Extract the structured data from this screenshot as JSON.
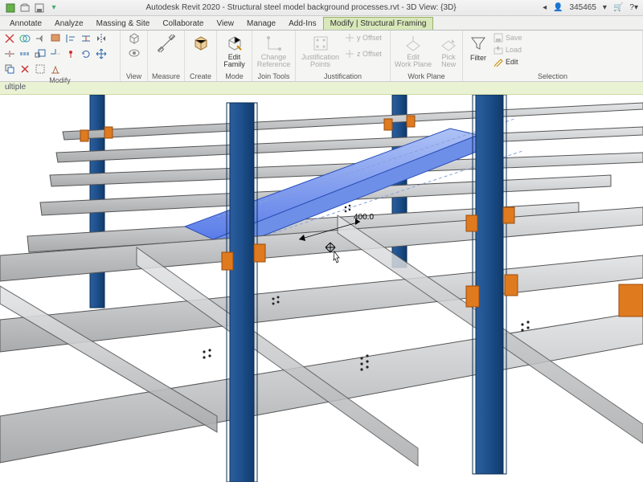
{
  "title": "Autodesk Revit 2020 - Structural steel model background processes.rvt - 3D View: {3D}",
  "user_count": "345465",
  "tabs": {
    "items": [
      "Annotate",
      "Analyze",
      "Massing & Site",
      "Collaborate",
      "View",
      "Manage",
      "Add-Ins"
    ],
    "active": "Modify | Structural Framing"
  },
  "ribbon": {
    "modify": {
      "label": "Modify"
    },
    "view": {
      "label": "View"
    },
    "measure": {
      "label": "Measure"
    },
    "create": {
      "label": "Create"
    },
    "mode": {
      "label": "Mode",
      "edit_family": "Edit\nFamily"
    },
    "join_tools": {
      "label": "Join Tools",
      "change_reference": "Change\nReference"
    },
    "justification": {
      "label": "Justification",
      "points": "Justification\nPoints",
      "y_offset": "y Offset",
      "z_offset": "z Offset"
    },
    "work_plane": {
      "label": "Work Plane",
      "edit_wp": "Edit\nWork Plane",
      "pick_new": "Pick\nNew"
    },
    "selection": {
      "label": "Selection",
      "filter": "Filter",
      "save": "Save",
      "load": "Load",
      "edit": "Edit"
    }
  },
  "status_text": "ultiple",
  "viewport": {
    "dimension_value": "400.0"
  },
  "colors": {
    "column": "#1d4f8b",
    "beam": "#c7c9cb",
    "conn": "#e07a1f",
    "hilite": "#5b7de8",
    "hilite_fill": "#8ba7f2"
  }
}
